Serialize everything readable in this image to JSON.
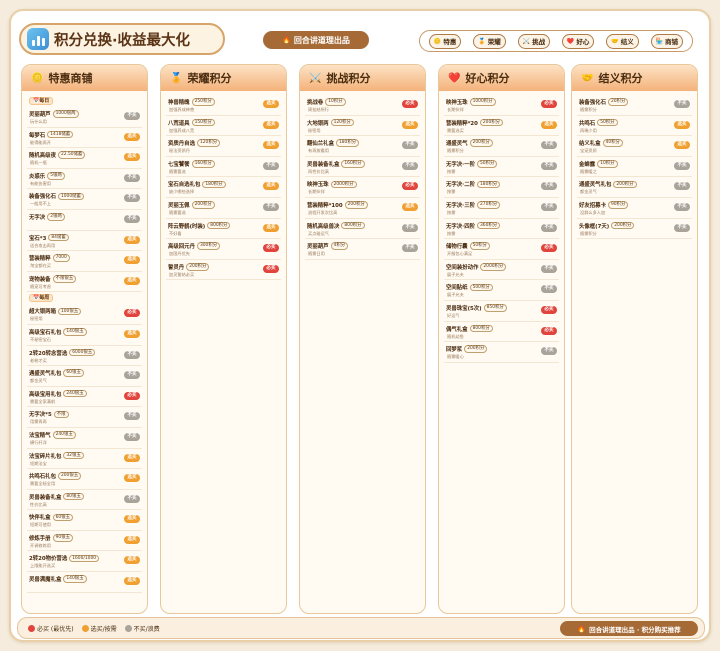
{
  "header": {
    "title": "积分兑换·收益最大化",
    "center_label": "回合讲道理出品",
    "nav": [
      {
        "icon": "🪙",
        "label": "特惠"
      },
      {
        "icon": "🏅",
        "label": "荣耀"
      },
      {
        "icon": "⚔️",
        "label": "挑战"
      },
      {
        "icon": "❤️",
        "label": "好心"
      },
      {
        "icon": "🤝",
        "label": "结义"
      },
      {
        "icon": "🏪",
        "label": "商铺"
      }
    ]
  },
  "badge_labels": {
    "must": "必买",
    "opt": "选买",
    "skip": "不买"
  },
  "columns": [
    {
      "icon": "🪙",
      "title": "特惠商铺",
      "accent": "#f4b27a",
      "rows": [
        {
          "section": "📅每日"
        },
        {
          "name": "灵丽葫芦",
          "price": "1000银两",
          "desc": "玩什么用",
          "badge": "skip"
        },
        {
          "name": "每梦石",
          "price": "1418储蓄",
          "desc": "能得能再开",
          "badge": "opt"
        },
        {
          "name": "随机高级夜",
          "price": "22.50储蓄",
          "desc": "随机一瓶",
          "badge": "opt"
        },
        {
          "name": "炎惑乐",
          "price": "5银两",
          "desc": "有能伤害用",
          "badge": "skip"
        },
        {
          "name": "装备强化石",
          "price": "1000储蓄",
          "desc": "一般用不上",
          "badge": "skip"
        },
        {
          "name": "无字决",
          "price": "2银两",
          "desc": "",
          "badge": "skip"
        },
        {
          "name": "宝石*3",
          "price": "84储蓄",
          "desc": "适合攻击再用",
          "badge": "opt"
        },
        {
          "name": "营装精粹",
          "price": "7000",
          "desc": "淘宝都在买",
          "badge": "opt"
        },
        {
          "name": "宠物装备",
          "price": "不限银玉",
          "desc": "随宠可考虑",
          "badge": "opt"
        },
        {
          "section": "📅每周"
        },
        {
          "name": "超大银两箱",
          "price": "100银玉",
          "desc": "秘密用",
          "badge": "must"
        },
        {
          "name": "高级宝石礼包",
          "price": "140银玉",
          "desc": "不秘密宝石",
          "badge": "opt"
        },
        {
          "name": "2转20转念营选",
          "price": "6000银玉",
          "desc": "老粉才买",
          "badge": "skip"
        },
        {
          "name": "遇盛灵气礼包",
          "price": "60银玉",
          "desc": "都金灵气",
          "badge": "skip"
        },
        {
          "name": "高级宝用礼包",
          "price": "240银玉",
          "desc": "需要全家满前",
          "badge": "must"
        },
        {
          "name": "无字决*5",
          "price": "不限",
          "desc": "用需再再",
          "badge": "skip"
        },
        {
          "name": "法宝精气",
          "price": "240银玉",
          "desc": "横行杆洋",
          "badge": "skip"
        },
        {
          "name": "法宝碎片礼包",
          "price": "32银玉",
          "desc": "短期法宝",
          "badge": "opt"
        },
        {
          "name": "共鸣石礼包",
          "price": "200银玉",
          "desc": "需要全秘全用",
          "badge": "opt"
        },
        {
          "name": "灵兽装备礼盒",
          "price": "80银玉",
          "desc": "性价比高",
          "badge": "skip"
        },
        {
          "name": "快伴礼盒",
          "price": "60银玉",
          "desc": "短期可使用",
          "badge": "opt"
        },
        {
          "name": "修炼手册",
          "price": "90银玉",
          "desc": "开调修炼用",
          "badge": "opt"
        },
        {
          "name": "2转20物价营选",
          "price": "1600/1000",
          "desc": "上限能开选买",
          "badge": "opt"
        },
        {
          "name": "灵兽满魔礼盒",
          "price": "140银玉",
          "desc": "",
          "badge": "opt"
        }
      ]
    },
    {
      "icon": "🏅",
      "title": "荣耀积分",
      "accent": "#f4b27a",
      "rows": [
        {
          "name": "神兽精魄",
          "price": "250积分",
          "desc": "加强养成神兽",
          "badge": "opt"
        },
        {
          "name": "八荒道具",
          "price": "150积分",
          "desc": "加强养成八荒",
          "badge": "opt"
        },
        {
          "name": "资质丹自选",
          "price": "120积分",
          "desc": "秘法资质丹",
          "badge": "opt"
        },
        {
          "name": "七宝饕餮",
          "price": "160积分",
          "desc": "随需要选",
          "badge": "skip"
        },
        {
          "name": "宝石自选礼包",
          "price": "180积分",
          "desc": "缺少哪些选择",
          "badge": "opt"
        },
        {
          "name": "灵丽玉佩",
          "price": "200积分",
          "desc": "随需要选",
          "badge": "skip"
        },
        {
          "name": "阵云野鹤(时装)",
          "price": "800积分",
          "desc": "不好看",
          "badge": "opt"
        },
        {
          "name": "高级回元丹",
          "price": "300积分",
          "desc": "加国丹优先",
          "badge": "must"
        },
        {
          "name": "誓灵丹",
          "price": "200积分",
          "desc": "加灵誓结必买",
          "badge": "must"
        }
      ]
    },
    {
      "icon": "⚔️",
      "title": "挑战积分",
      "accent": "#f4b27a",
      "rows": [
        {
          "name": "挑战卷",
          "price": "10积分",
          "desc": "周挂结所行",
          "badge": "must"
        },
        {
          "name": "大地银两",
          "price": "120积分",
          "desc": "秘密用",
          "badge": "opt"
        },
        {
          "name": "翻仙兰礼盒",
          "price": "180积分",
          "desc": "有再按看用",
          "badge": "skip"
        },
        {
          "name": "灵兽装备礼盒",
          "price": "160积分",
          "desc": "再性价比高",
          "badge": "skip"
        },
        {
          "name": "映神玉珠",
          "price": "2000积分",
          "desc": "长期伙伴",
          "badge": "must"
        },
        {
          "name": "营装精粹*100",
          "price": "200积分",
          "desc": "流程开发次比高",
          "badge": "opt"
        },
        {
          "name": "随机高级兽决",
          "price": "800积分",
          "desc": "买点碰运气",
          "badge": "skip"
        },
        {
          "name": "灵丽葫芦",
          "price": "4积分",
          "desc": "随需日用",
          "badge": "skip"
        }
      ]
    },
    {
      "icon": "❤️",
      "title": "好心积分",
      "accent": "#f4b27a",
      "rows": [
        {
          "name": "映神玉珠",
          "price": "1000积分",
          "desc": "长期伙伴",
          "badge": "must"
        },
        {
          "name": "营装精粹*20",
          "price": "200积分",
          "desc": "需要选买",
          "badge": "opt"
        },
        {
          "name": "通盛灵气",
          "price": "200积分",
          "desc": "随需积分",
          "badge": "skip"
        },
        {
          "name": "无字决·一阶",
          "price": "50积分",
          "desc": "按需",
          "badge": "skip"
        },
        {
          "name": "无字决·二阶",
          "price": "180积分",
          "desc": "按需",
          "badge": "skip"
        },
        {
          "name": "无字决·三阶",
          "price": "270积分",
          "desc": "按需",
          "badge": "skip"
        },
        {
          "name": "无字决·四阶",
          "price": "360积分",
          "desc": "按需",
          "badge": "skip"
        },
        {
          "name": "储物行囊",
          "price": "50积分",
          "desc": "开服包心满足",
          "badge": "must"
        },
        {
          "name": "空间装扮动作",
          "price": "2000积分",
          "desc": "展子允夫",
          "badge": "skip"
        },
        {
          "name": "空间贴纸",
          "price": "500积分",
          "desc": "展子允夫",
          "badge": "skip"
        },
        {
          "name": "灵兽珠宝(5次)",
          "price": "850积分",
          "desc": "好运气",
          "badge": "must"
        },
        {
          "name": "偶气礼盒",
          "price": "800积分",
          "desc": "随机幼鱼",
          "badge": "must"
        },
        {
          "name": "回梦浆",
          "price": "200积分",
          "desc": "随需暖心",
          "badge": "skip"
        }
      ]
    },
    {
      "icon": "🤝",
      "title": "结义积分",
      "accent": "#f4b27a",
      "rows": [
        {
          "name": "装备强化石",
          "price": "20积分",
          "desc": "随需积分",
          "badge": "skip"
        },
        {
          "name": "共鸣石",
          "price": "50积分",
          "desc": "再稀少用",
          "badge": "opt"
        },
        {
          "name": "结义礼盒",
          "price": "40积分",
          "desc": "宝宠资质",
          "badge": "opt"
        },
        {
          "name": "金蝉露",
          "price": "10积分",
          "desc": "随需暖之",
          "badge": "skip"
        },
        {
          "name": "通盛灵气礼包",
          "price": "200积分",
          "desc": "都金灵气",
          "badge": "skip"
        },
        {
          "name": "好友招募卡",
          "price": "90积分",
          "desc": "没群么多人加",
          "badge": "skip"
        },
        {
          "name": "头像框(7天)",
          "price": "200积分",
          "desc": "随需积分",
          "badge": "skip"
        }
      ]
    }
  ],
  "footer": {
    "legend": [
      {
        "color": "#e0443c",
        "label": "必买 (最优先)"
      },
      {
        "color": "#f0a030",
        "label": "选买/按需"
      },
      {
        "color": "#a9a39a",
        "label": "不买/浪费"
      }
    ],
    "credit": "回合讲道理出品 · 积分购买推荐"
  }
}
